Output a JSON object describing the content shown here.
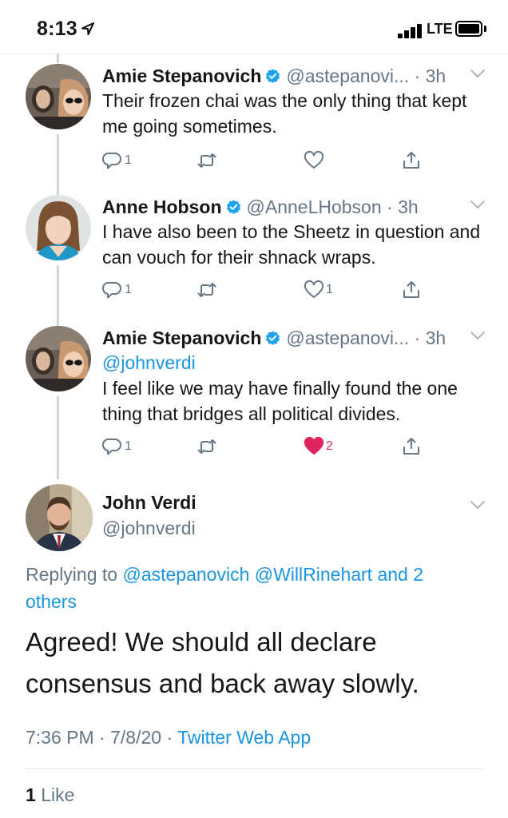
{
  "status_bar": {
    "time": "8:13",
    "network": "LTE"
  },
  "replies": [
    {
      "name": "Amie Stepanovich",
      "handle": "@astepanovi...",
      "sep": " · ",
      "time": "3h",
      "mention": "",
      "text": "Their frozen chai was the only thing that kept me going sometimes.",
      "counts": {
        "reply": "1",
        "retweet": "",
        "like": "",
        "share": ""
      },
      "liked": false
    },
    {
      "name": "Anne Hobson",
      "handle": "@AnneLHobson",
      "sep": " · ",
      "time": "3h",
      "mention": "",
      "text": "I have also been to the Sheetz in question and can vouch for their shnack wraps.",
      "counts": {
        "reply": "1",
        "retweet": "",
        "like": "1",
        "share": ""
      },
      "liked": false
    },
    {
      "name": "Amie Stepanovich",
      "handle": "@astepanovi...",
      "sep": " · ",
      "time": "3h",
      "mention": "@johnverdi",
      "text": "I feel like we may have finally found the one thing that bridges all political divides.",
      "counts": {
        "reply": "1",
        "retweet": "",
        "like": "2",
        "share": ""
      },
      "liked": true
    }
  ],
  "main_tweet": {
    "name": "John Verdi",
    "handle": "@johnverdi",
    "replying_prefix": "Replying to ",
    "replying_to_1": "@astepanovich",
    "replying_to_2": "@WillRinehart",
    "replying_others": "and 2 others",
    "text": "Agreed! We should all declare consensus and back away slowly.",
    "time": "7:36 PM",
    "date": "7/8/20",
    "app": "Twitter Web App",
    "like_count": "1",
    "like_label": "Like"
  },
  "colors": {
    "link": "#1b95e0",
    "secondary": "#657786",
    "like": "#e0245e",
    "verified": "#1da1f2"
  },
  "icons": [
    "location-arrow-icon",
    "signal-icon",
    "battery-icon",
    "verified-badge-icon",
    "chevron-down-icon",
    "reply-icon",
    "retweet-icon",
    "like-icon",
    "share-icon"
  ]
}
